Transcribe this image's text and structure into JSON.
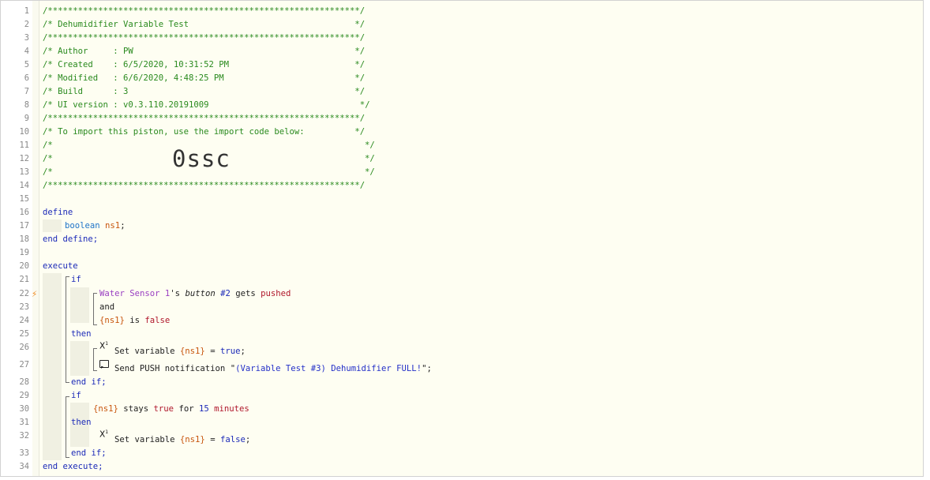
{
  "line_numbers": [
    "1",
    "2",
    "3",
    "4",
    "5",
    "6",
    "7",
    "8",
    "9",
    "10",
    "11",
    "12",
    "13",
    "14",
    "15",
    "16",
    "17",
    "18",
    "19",
    "20",
    "21",
    "22",
    "23",
    "24",
    "25",
    "26",
    "27",
    "28",
    "29",
    "30",
    "31",
    "32",
    "33",
    "34"
  ],
  "header": {
    "border": "/**************************************************************/",
    "title": "/* Dehumidifier Variable Test                                 */",
    "author": "/* Author     : PW                                            */",
    "created": "/* Created    : 6/5/2020, 10:31:52 PM                         */",
    "modified": "/* Modified   : 6/6/2020, 4:48:25 PM                          */",
    "build": "/* Build      : 3                                             */",
    "ui_version": "/* UI version : v0.3.110.20191009                              */",
    "import_note": "/* To import this piston, use the import code below:          */",
    "blank_left": "/*",
    "blank_right": "*/",
    "import_code": "0ssc"
  },
  "code": {
    "define": "define",
    "boolean": "boolean",
    "ns1_decl": "ns1",
    "semicolon": ";",
    "end_define": "end define;",
    "execute": "execute",
    "if": "if",
    "device": "Water Sensor 1",
    "possessive": "'s ",
    "button": "button",
    "button_num": "#2",
    "gets": " gets ",
    "pushed": "pushed",
    "and": "and",
    "ns1_ref": "{ns1}",
    "is": " is ",
    "false": "false",
    "true": "true",
    "then": "then",
    "set_variable": "Set variable ",
    "equals": " = ",
    "send_push": "Send PUSH notification \"",
    "push_message": "(Variable Test #3) Dehumidifier FULL!",
    "push_end": "\";",
    "end_if": "end if;",
    "stays": " stays ",
    "for": " for ",
    "fifteen": "15",
    "minutes": "minutes",
    "end_execute": "end execute;"
  },
  "icons": {
    "trigger": "lightning-bolt-icon",
    "set_variable": "variable-x-icon",
    "notification": "message-icon"
  }
}
